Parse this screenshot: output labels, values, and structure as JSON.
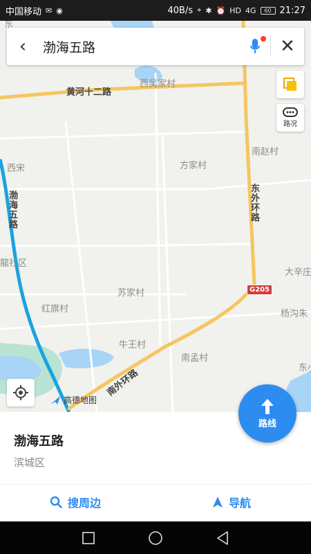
{
  "status_bar": {
    "carrier": "中国移动",
    "network_speed": "40B/s",
    "hd": "HD",
    "signal": "4G",
    "battery": "60",
    "time": "21:27"
  },
  "search": {
    "query": "渤海五路"
  },
  "map": {
    "labels": {
      "xiwu": "西吴家村",
      "huanghe": "黄河十二路",
      "nanzhao": "南赵村",
      "fangjia": "方家村",
      "xisong": "西宋",
      "bohai_vertical": "渤海五路",
      "dongwai": "东外环路",
      "longshequ": "龍社区",
      "daxin": "大辛庄",
      "sujia": "苏家村",
      "hongqi": "红旗村",
      "yanggou": "杨沟朱",
      "niuwang": "牛王村",
      "nanmeng": "南孟村",
      "dong_partial": "东小",
      "nanwai": "南外环路",
      "top_partial": "东"
    },
    "g205": "G205",
    "traffic_label": "路况",
    "logo_text": "高德地图"
  },
  "route_button": {
    "label": "路线"
  },
  "info": {
    "name": "渤海五路",
    "district": "滨城区",
    "nearby_label": "搜周边",
    "navigate_label": "导航"
  },
  "colors": {
    "accent": "#2d8cf0",
    "highlight_road": "#1aa3e0",
    "main_road": "#f5c660"
  }
}
